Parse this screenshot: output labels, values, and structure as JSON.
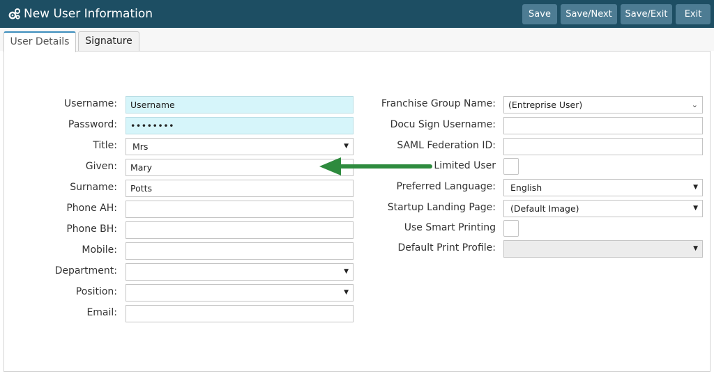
{
  "window": {
    "title": "New User Information",
    "icon": "gears-icon",
    "accent_color": "#1d4e63",
    "button_color": "#4d7c93"
  },
  "toolbar": {
    "save_label": "Save",
    "save_next_label": "Save/Next",
    "save_exit_label": "Save/Exit",
    "exit_label": "Exit"
  },
  "tabs": [
    {
      "label": "User Details",
      "active": true
    },
    {
      "label": "Signature",
      "active": false
    }
  ],
  "left_form": {
    "username": {
      "label": "Username:",
      "value": "Username"
    },
    "password": {
      "label": "Password:",
      "value": "••••••••"
    },
    "title": {
      "label": "Title:",
      "value": "Mrs"
    },
    "given": {
      "label": "Given:",
      "value": "Mary"
    },
    "surname": {
      "label": "Surname:",
      "value": "Potts"
    },
    "phone_ah": {
      "label": "Phone AH:",
      "value": ""
    },
    "phone_bh": {
      "label": "Phone BH:",
      "value": ""
    },
    "mobile": {
      "label": "Mobile:",
      "value": ""
    },
    "department": {
      "label": "Department:",
      "value": ""
    },
    "position": {
      "label": "Position:",
      "value": ""
    },
    "email": {
      "label": "Email:",
      "value": ""
    }
  },
  "right_form": {
    "franchise_group": {
      "label": "Franchise Group Name:",
      "value": "(Entreprise User)"
    },
    "docu_sign": {
      "label": "Docu Sign Username:",
      "value": ""
    },
    "saml_federation": {
      "label": "SAML Federation ID:",
      "value": ""
    },
    "limited_user": {
      "label": "Limited User",
      "checked": false
    },
    "preferred_language": {
      "label": "Preferred Language:",
      "value": "English"
    },
    "startup_landing_page": {
      "label": "Startup Landing Page:",
      "value": "(Default Image)"
    },
    "smart_printing": {
      "label": "Use Smart Printing",
      "checked": false
    },
    "default_print_profile": {
      "label": "Default Print Profile:",
      "value": ""
    }
  },
  "annotation": {
    "arrow_color": "#2e8b3e",
    "icon": "arrow-left-icon"
  }
}
